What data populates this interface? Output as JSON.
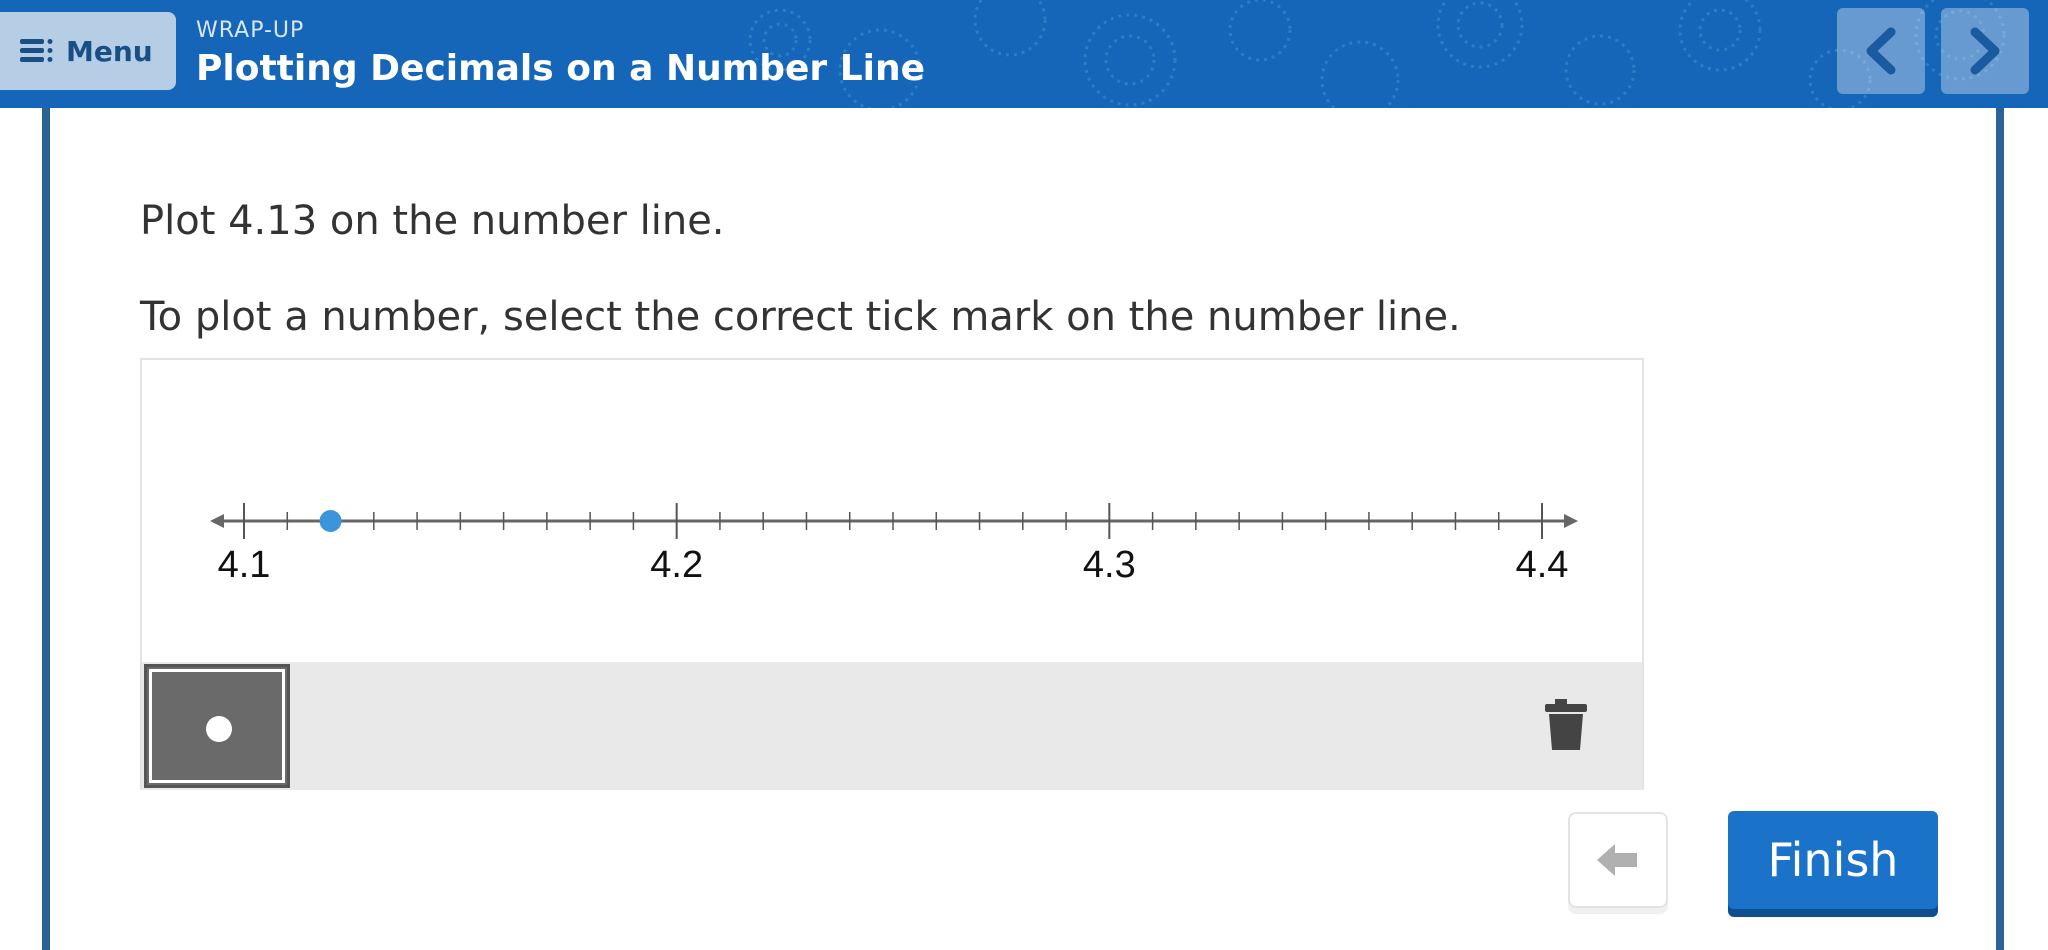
{
  "header": {
    "menu_label": "Menu",
    "subtitle": "WRAP-UP",
    "title": "Plotting Decimals on a Number Line"
  },
  "question": {
    "prompt": "Plot 4.13 on the number line.",
    "instruction": "To plot a number, select the correct tick mark on the number line."
  },
  "number_line": {
    "min": 4.1,
    "max": 4.4,
    "minor_step": 0.01,
    "labels": [
      "4.1",
      "4.2",
      "4.3",
      "4.4"
    ],
    "plotted_point": 4.12,
    "point_color": "#3a95dc"
  },
  "footer": {
    "finish_label": "Finish"
  },
  "colors": {
    "header_bg": "#1565b8",
    "accent": "#1a73c9",
    "border": "#2b6494"
  }
}
